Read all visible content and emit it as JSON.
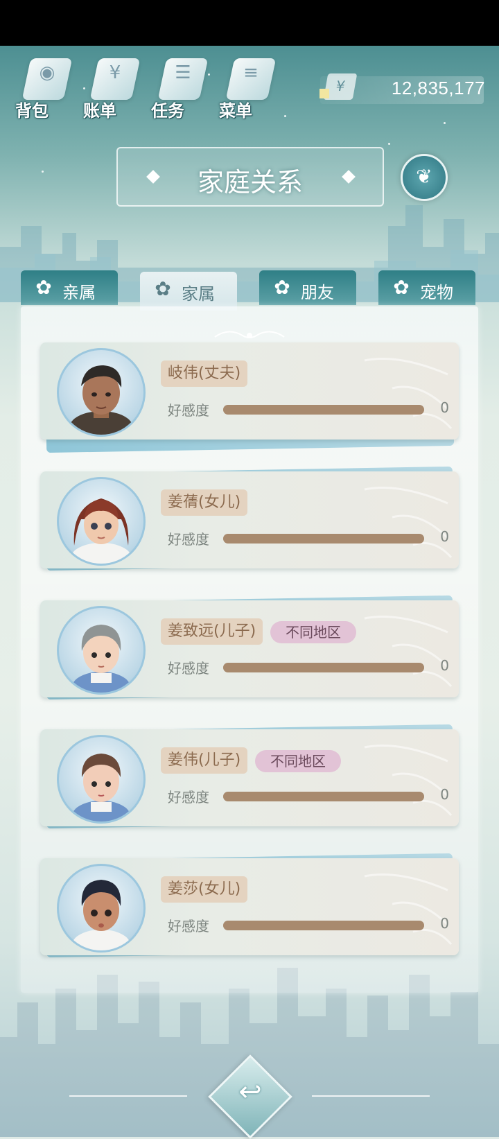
{
  "top_menu": [
    {
      "label": "背包",
      "icon": "bag-icon"
    },
    {
      "label": "账单",
      "icon": "bill-icon"
    },
    {
      "label": "任务",
      "icon": "task-icon"
    },
    {
      "label": "菜单",
      "icon": "menu-icon"
    }
  ],
  "currency": {
    "symbol": "¥",
    "amount": "12,835,177"
  },
  "page_title": "家庭关系",
  "tabs": [
    {
      "label": "亲属",
      "active": false
    },
    {
      "label": "家属",
      "active": true
    },
    {
      "label": "朋友",
      "active": false
    },
    {
      "label": "宠物",
      "active": false
    }
  ],
  "members": [
    {
      "name": "岐伟(丈夫)",
      "region": "",
      "affection_label": "好感度",
      "affection_value": "0",
      "affection_fill_percent": 100,
      "avatar": "male-adult"
    },
    {
      "name": "姜蒨(女儿)",
      "region": "",
      "affection_label": "好感度",
      "affection_value": "0",
      "affection_fill_percent": 100,
      "avatar": "girl-red-hair"
    },
    {
      "name": "姜致远(儿子)",
      "region": "不同地区",
      "affection_label": "好感度",
      "affection_value": "0",
      "affection_fill_percent": 100,
      "avatar": "boy-gray-hair"
    },
    {
      "name": "姜伟(儿子)",
      "region": "不同地区",
      "affection_label": "好感度",
      "affection_value": "0",
      "affection_fill_percent": 100,
      "avatar": "boy-brown-hair"
    },
    {
      "name": "姜莎(女儿)",
      "region": "",
      "affection_label": "好感度",
      "affection_value": "0",
      "affection_fill_percent": 100,
      "avatar": "child-dark-hair"
    }
  ],
  "colors": {
    "accent": "#3d8590",
    "name_tag": "#e4d3c0",
    "region_badge": "#e2c3d6",
    "affection_fill": "#a88a6e"
  }
}
